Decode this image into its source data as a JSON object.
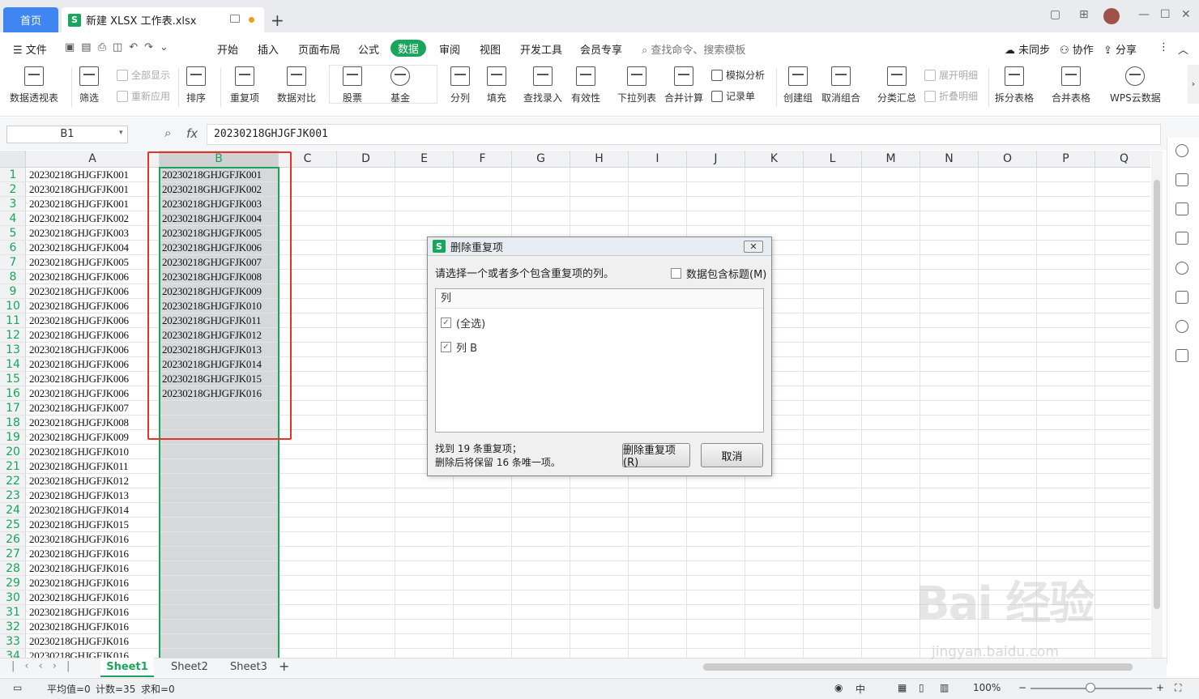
{
  "tabs": {
    "home": "首页",
    "doc": "新建 XLSX 工作表.xlsx"
  },
  "menu": {
    "file": "文件",
    "items": [
      "开始",
      "插入",
      "页面布局",
      "公式",
      "数据",
      "审阅",
      "视图",
      "开发工具",
      "会员专享"
    ],
    "search": "查找命令、搜索模板",
    "right": [
      "未同步",
      "协作",
      "分享"
    ]
  },
  "ribbon": {
    "large": [
      "数据透视表",
      "筛选",
      "排序",
      "重复项",
      "数据对比",
      "股票",
      "基金",
      "分列",
      "填充",
      "查找录入",
      "有效性",
      "下拉列表",
      "合并计算",
      "创建组",
      "取消组合",
      "分类汇总",
      "拆分表格",
      "合并表格",
      "WPS云数据"
    ],
    "small": {
      "show_all": "全部显示",
      "reapply": "重新应用",
      "simulate": "模拟分析",
      "record": "记录单",
      "expand": "展开明细",
      "collapse": "折叠明细"
    }
  },
  "formula": {
    "namebox": "B1",
    "fx": "fx",
    "value": "20230218GHJGFJK001"
  },
  "columns": [
    "A",
    "B",
    "C",
    "D",
    "E",
    "F",
    "G",
    "H",
    "I",
    "J",
    "K",
    "L",
    "M",
    "N",
    "O",
    "P",
    "Q"
  ],
  "rows": [
    "1",
    "2",
    "3",
    "4",
    "5",
    "6",
    "7",
    "8",
    "9",
    "10",
    "11",
    "12",
    "13",
    "14",
    "15",
    "16",
    "17",
    "18",
    "19",
    "20",
    "21",
    "22",
    "23",
    "24",
    "25",
    "26",
    "27",
    "28",
    "29",
    "30",
    "31",
    "32",
    "33",
    "34"
  ],
  "colA": [
    "20230218GHJGFJK001",
    "20230218GHJGFJK001",
    "20230218GHJGFJK001",
    "20230218GHJGFJK002",
    "20230218GHJGFJK003",
    "20230218GHJGFJK004",
    "20230218GHJGFJK005",
    "20230218GHJGFJK006",
    "20230218GHJGFJK006",
    "20230218GHJGFJK006",
    "20230218GHJGFJK006",
    "20230218GHJGFJK006",
    "20230218GHJGFJK006",
    "20230218GHJGFJK006",
    "20230218GHJGFJK006",
    "20230218GHJGFJK006",
    "20230218GHJGFJK007",
    "20230218GHJGFJK008",
    "20230218GHJGFJK009",
    "20230218GHJGFJK010",
    "20230218GHJGFJK011",
    "20230218GHJGFJK012",
    "20230218GHJGFJK013",
    "20230218GHJGFJK014",
    "20230218GHJGFJK015",
    "20230218GHJGFJK016",
    "20230218GHJGFJK016",
    "20230218GHJGFJK016",
    "20230218GHJGFJK016",
    "20230218GHJGFJK016",
    "20230218GHJGFJK016",
    "20230218GHJGFJK016",
    "20230218GHJGFJK016",
    "20230218GHJGFJK016"
  ],
  "colB": [
    "20230218GHJGFJK001",
    "20230218GHJGFJK002",
    "20230218GHJGFJK003",
    "20230218GHJGFJK004",
    "20230218GHJGFJK005",
    "20230218GHJGFJK006",
    "20230218GHJGFJK007",
    "20230218GHJGFJK008",
    "20230218GHJGFJK009",
    "20230218GHJGFJK010",
    "20230218GHJGFJK011",
    "20230218GHJGFJK012",
    "20230218GHJGFJK013",
    "20230218GHJGFJK014",
    "20230218GHJGFJK015",
    "20230218GHJGFJK016"
  ],
  "dialog": {
    "title": "删除重复项",
    "prompt": "请选择一个或者多个包含重复项的列。",
    "header_checkbox": "数据包含标题(M)",
    "list_header": "列",
    "items": [
      "(全选)",
      "列 B"
    ],
    "found": "找到 19 条重复项；",
    "keep": "删除后将保留 16 条唯一项。",
    "delete_btn": "删除重复项(R)",
    "cancel_btn": "取消"
  },
  "sheets": [
    "Sheet1",
    "Sheet2",
    "Sheet3"
  ],
  "status": {
    "avg": "平均值=0",
    "count": "计数=35",
    "sum": "求和=0",
    "zoom": "100%"
  },
  "watermark": {
    "brand": "Bai 经验",
    "url": "jingyan.baidu.com"
  },
  "colors": {
    "accent": "#19a55b",
    "home_tab": "#3f86f3",
    "highlight_box": "#e5332a"
  }
}
